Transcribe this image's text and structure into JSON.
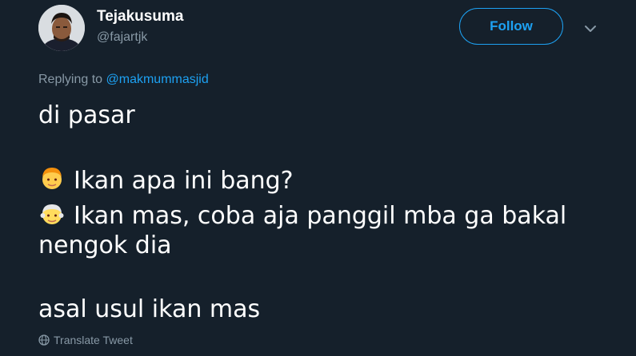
{
  "user": {
    "display_name": "Tejakusuma",
    "username": "@fajartjk"
  },
  "actions": {
    "follow_label": "Follow"
  },
  "reply": {
    "prefix": "Replying to ",
    "mention": "@makmummasjid"
  },
  "tweet": {
    "line1": "di pasar",
    "line2": "Ikan apa ini bang?",
    "line3": "Ikan mas, coba aja panggil mba ga bakal",
    "line4": "nengok dia",
    "line5": "asal usul ikan mas",
    "emoji1": "man-emoji",
    "emoji2": "older-man-emoji"
  },
  "footer": {
    "translate_label": "Translate Tweet"
  },
  "colors": {
    "background": "#15202b",
    "accent": "#1da1f2",
    "secondary_text": "#8899a6",
    "primary_text": "#ffffff"
  }
}
